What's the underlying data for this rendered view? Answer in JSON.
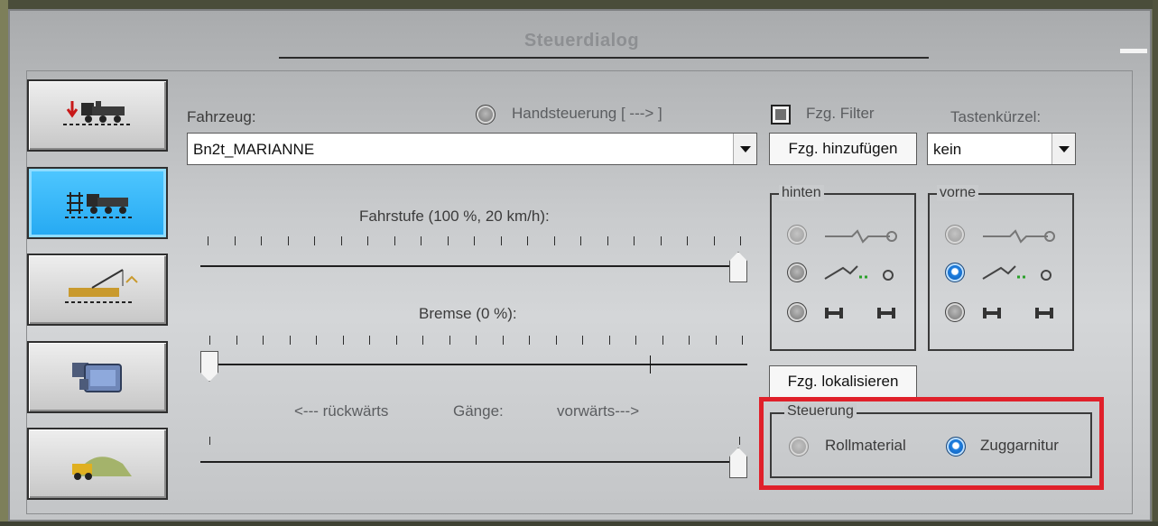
{
  "window": {
    "title": "Steuerdialog"
  },
  "nav": {
    "buttons": [
      {
        "id": "insert-train",
        "active": false
      },
      {
        "id": "control-train",
        "active": true
      },
      {
        "id": "crane",
        "active": false
      },
      {
        "id": "camera",
        "active": false
      },
      {
        "id": "landscape",
        "active": false
      }
    ]
  },
  "vehicle": {
    "label": "Fahrzeug:",
    "selected": "Bn2t_MARIANNE",
    "manual_control_label": "Handsteuerung [ ---> ]",
    "filter_label": "Fzg. Filter",
    "add_button": "Fzg. hinzufügen",
    "shortcut_label": "Tastenkürzel:",
    "shortcut_value": "kein",
    "locate_button": "Fzg. lokalisieren"
  },
  "sliders": {
    "speed_label": "Fahrstufe (100 %, 20 km/h):",
    "speed_level": 1.0,
    "brake_label": "Bremse (0 %):",
    "brake_level": 0.0,
    "gears_back": "<--- rückwärts",
    "gears_label": "Gänge:",
    "gears_forward": "vorwärts--->",
    "gear_level": 1.0
  },
  "couplings": {
    "rear": {
      "title": "hinten",
      "selected": 1
    },
    "front": {
      "title": "vorne",
      "selected": 1
    }
  },
  "control": {
    "title": "Steuerung",
    "options": [
      "Rollmaterial",
      "Zuggarnitur"
    ],
    "selected": "Zuggarnitur"
  },
  "colors": {
    "highlight": "#e0202a",
    "active_nav": "#2aaef5",
    "radio_on": "#1f7fe0"
  }
}
